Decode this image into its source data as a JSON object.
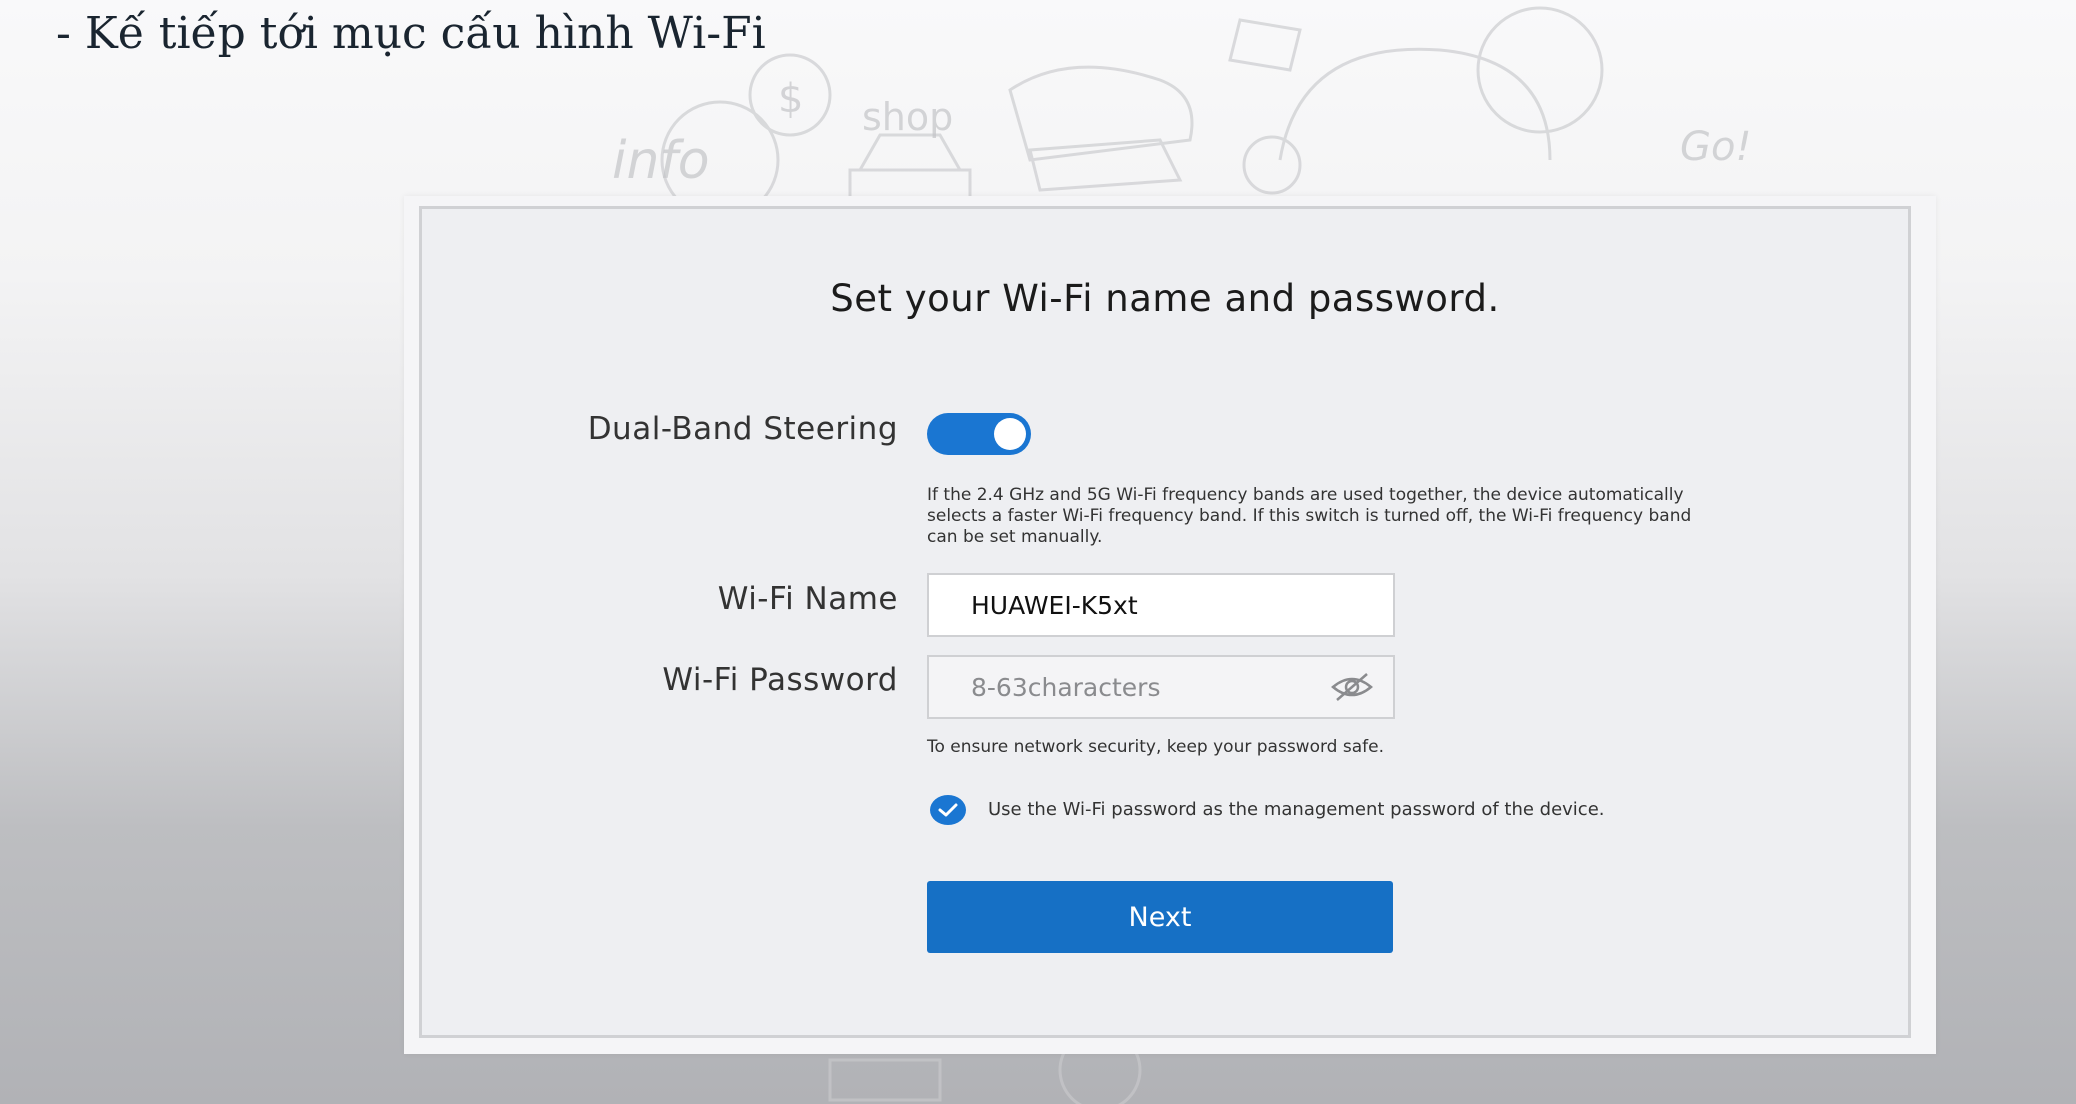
{
  "slide": {
    "heading": "- Kế tiếp tới mục cấu hình Wi-Fi"
  },
  "background_doodles": {
    "info_text": "info",
    "shop_text": "shop",
    "go_text": "Go!",
    "dollar_text": "$"
  },
  "wizard": {
    "title": "Set your Wi-Fi name and password.",
    "dual_band": {
      "label": "Dual-Band Steering",
      "enabled": true,
      "help_lines": [
        "If the 2.4 GHz and 5G Wi-Fi frequency bands are used together, the device automatically",
        "selects a faster Wi-Fi frequency band. If this switch is turned off, the Wi-Fi frequency band",
        "can be set manually."
      ]
    },
    "wifi_name": {
      "label": "Wi-Fi Name",
      "value": "HUAWEI-K5xt"
    },
    "wifi_password": {
      "label": "Wi-Fi Password",
      "value": "",
      "placeholder": "8-63characters",
      "toggle_icon": "eye-icon",
      "hint": "To ensure network security, keep your password safe."
    },
    "management_password": {
      "checked": true,
      "label": "Use the Wi-Fi password as the management password of the device."
    },
    "next_button": "Next"
  },
  "colors": {
    "accent": "#1a76d2",
    "button": "#1670c5",
    "panel": "#eeeff2",
    "heading": "#1a2530"
  }
}
